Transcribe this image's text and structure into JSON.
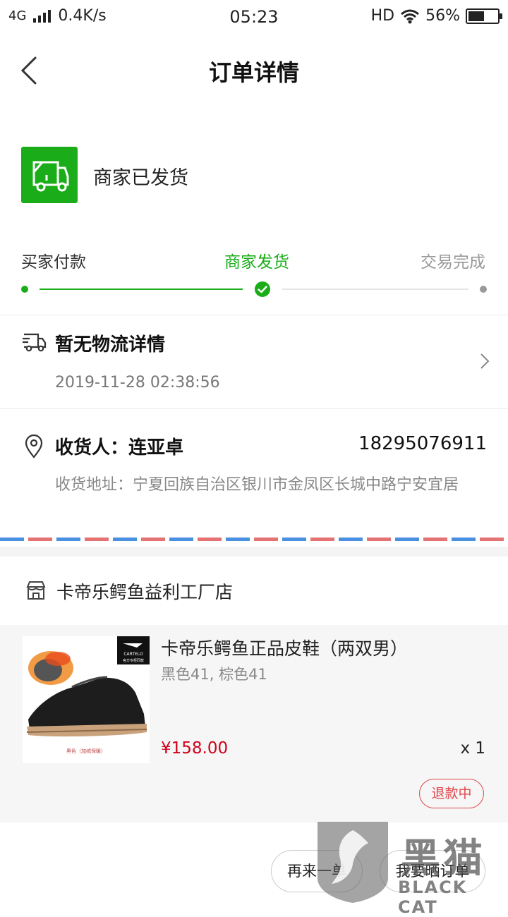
{
  "status_bar": {
    "network": "4G",
    "speed": "0.4K/s",
    "time": "05:23",
    "hd": "HD",
    "battery": "56%",
    "battery_level": 0.56
  },
  "header": {
    "title": "订单详情"
  },
  "order_status": {
    "text": "商家已发货",
    "color": "#1aad19"
  },
  "progress": {
    "steps": [
      "买家付款",
      "商家发货",
      "交易完成"
    ],
    "current": 1,
    "active_color": "#1aad19",
    "inactive_color": "#999999"
  },
  "logistics": {
    "title": "暂无物流详情",
    "time": "2019-11-28 02:38:56"
  },
  "address": {
    "receiver": "收货人：连亚卓",
    "phone": "18295076911",
    "detail": "收货地址：宁夏回族自治区银川市金凤区长城中路宁安宜居"
  },
  "shop": {
    "name": "卡帝乐鳄鱼益利工厂店"
  },
  "product": {
    "title": "卡帝乐鳄鱼正品皮鞋（两双男）",
    "sku": "黑色41, 棕色41",
    "price": "¥158.00",
    "quantity": "x 1",
    "brand": "CARTELO",
    "brand_tag": "官方专柜同款",
    "caption": "黑色（加绒保暖）",
    "status_badge": "退款中",
    "price_color": "#d0021b"
  },
  "actions": {
    "reorder": "再来一单",
    "share": "我要晒订单"
  },
  "watermark": {
    "cn": "黑猫",
    "en": "BLACK CAT"
  }
}
